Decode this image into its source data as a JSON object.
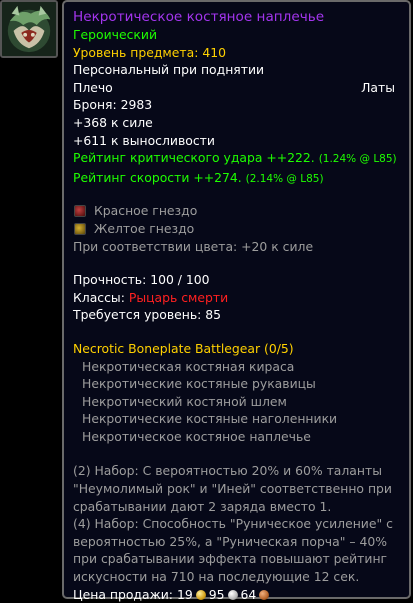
{
  "item": {
    "name": "Некротическое костяное наплечье",
    "quality": "Героический",
    "item_level": "Уровень предмета: 410",
    "binding": "Персональный при поднятии",
    "slot": "Плечо",
    "armor_type": "Латы",
    "armor": "Броня: 2983",
    "stats": [
      "+368 к силе",
      "+611 к выносливости"
    ],
    "ratings": [
      {
        "text": "Рейтинг критического удара ++222.",
        "detail": "(1.24% @ L85)"
      },
      {
        "text": "Рейтинг скорости ++274.",
        "detail": "(2.14% @ L85)"
      }
    ],
    "sockets": [
      {
        "label": "Красное гнездо",
        "color": "#b02020"
      },
      {
        "label": "Желтое гнездо",
        "color": "#c8a020"
      }
    ],
    "socket_bonus": "При соответствии цвета: +20 к силе",
    "durability": "Прочность: 100 / 100",
    "classes_label": "Классы:",
    "classes_value": "Рыцарь смерти",
    "required_level": "Требуется уровень: 85"
  },
  "set": {
    "name": "Necrotic Boneplate Battlegear (0/5)",
    "items": [
      "Некротическая костяная кираса",
      "Некротические костяные рукавицы",
      "Некротический костяной шлем",
      "Некротические костяные наголенники",
      "Некротическое костяное наплечье"
    ],
    "bonuses": [
      "(2) Набор: С вероятностью 20% и 60% таланты \"Неумолимый рок\" и \"Иней\" соответственно при срабатывании дают 2 заряда вместо 1.",
      "(4) Набор: Способность \"Руническое усиление\" с вероятностью 25%, а \"Руническая порча\" – 40% при срабатывании эффекта повышают рейтинг искусности на 710 на последующие 12 сек."
    ]
  },
  "sell_price": {
    "label": "Цена продажи:",
    "gold": "19",
    "silver": "95",
    "copper": "64"
  },
  "colors": {
    "epic": "#a335ee",
    "uncommon": "#1eff00",
    "gold_text": "#ffd100",
    "gray_text": "#9d9d9d",
    "red_text": "#ff2020"
  },
  "icon": "shoulder-armor-icon"
}
